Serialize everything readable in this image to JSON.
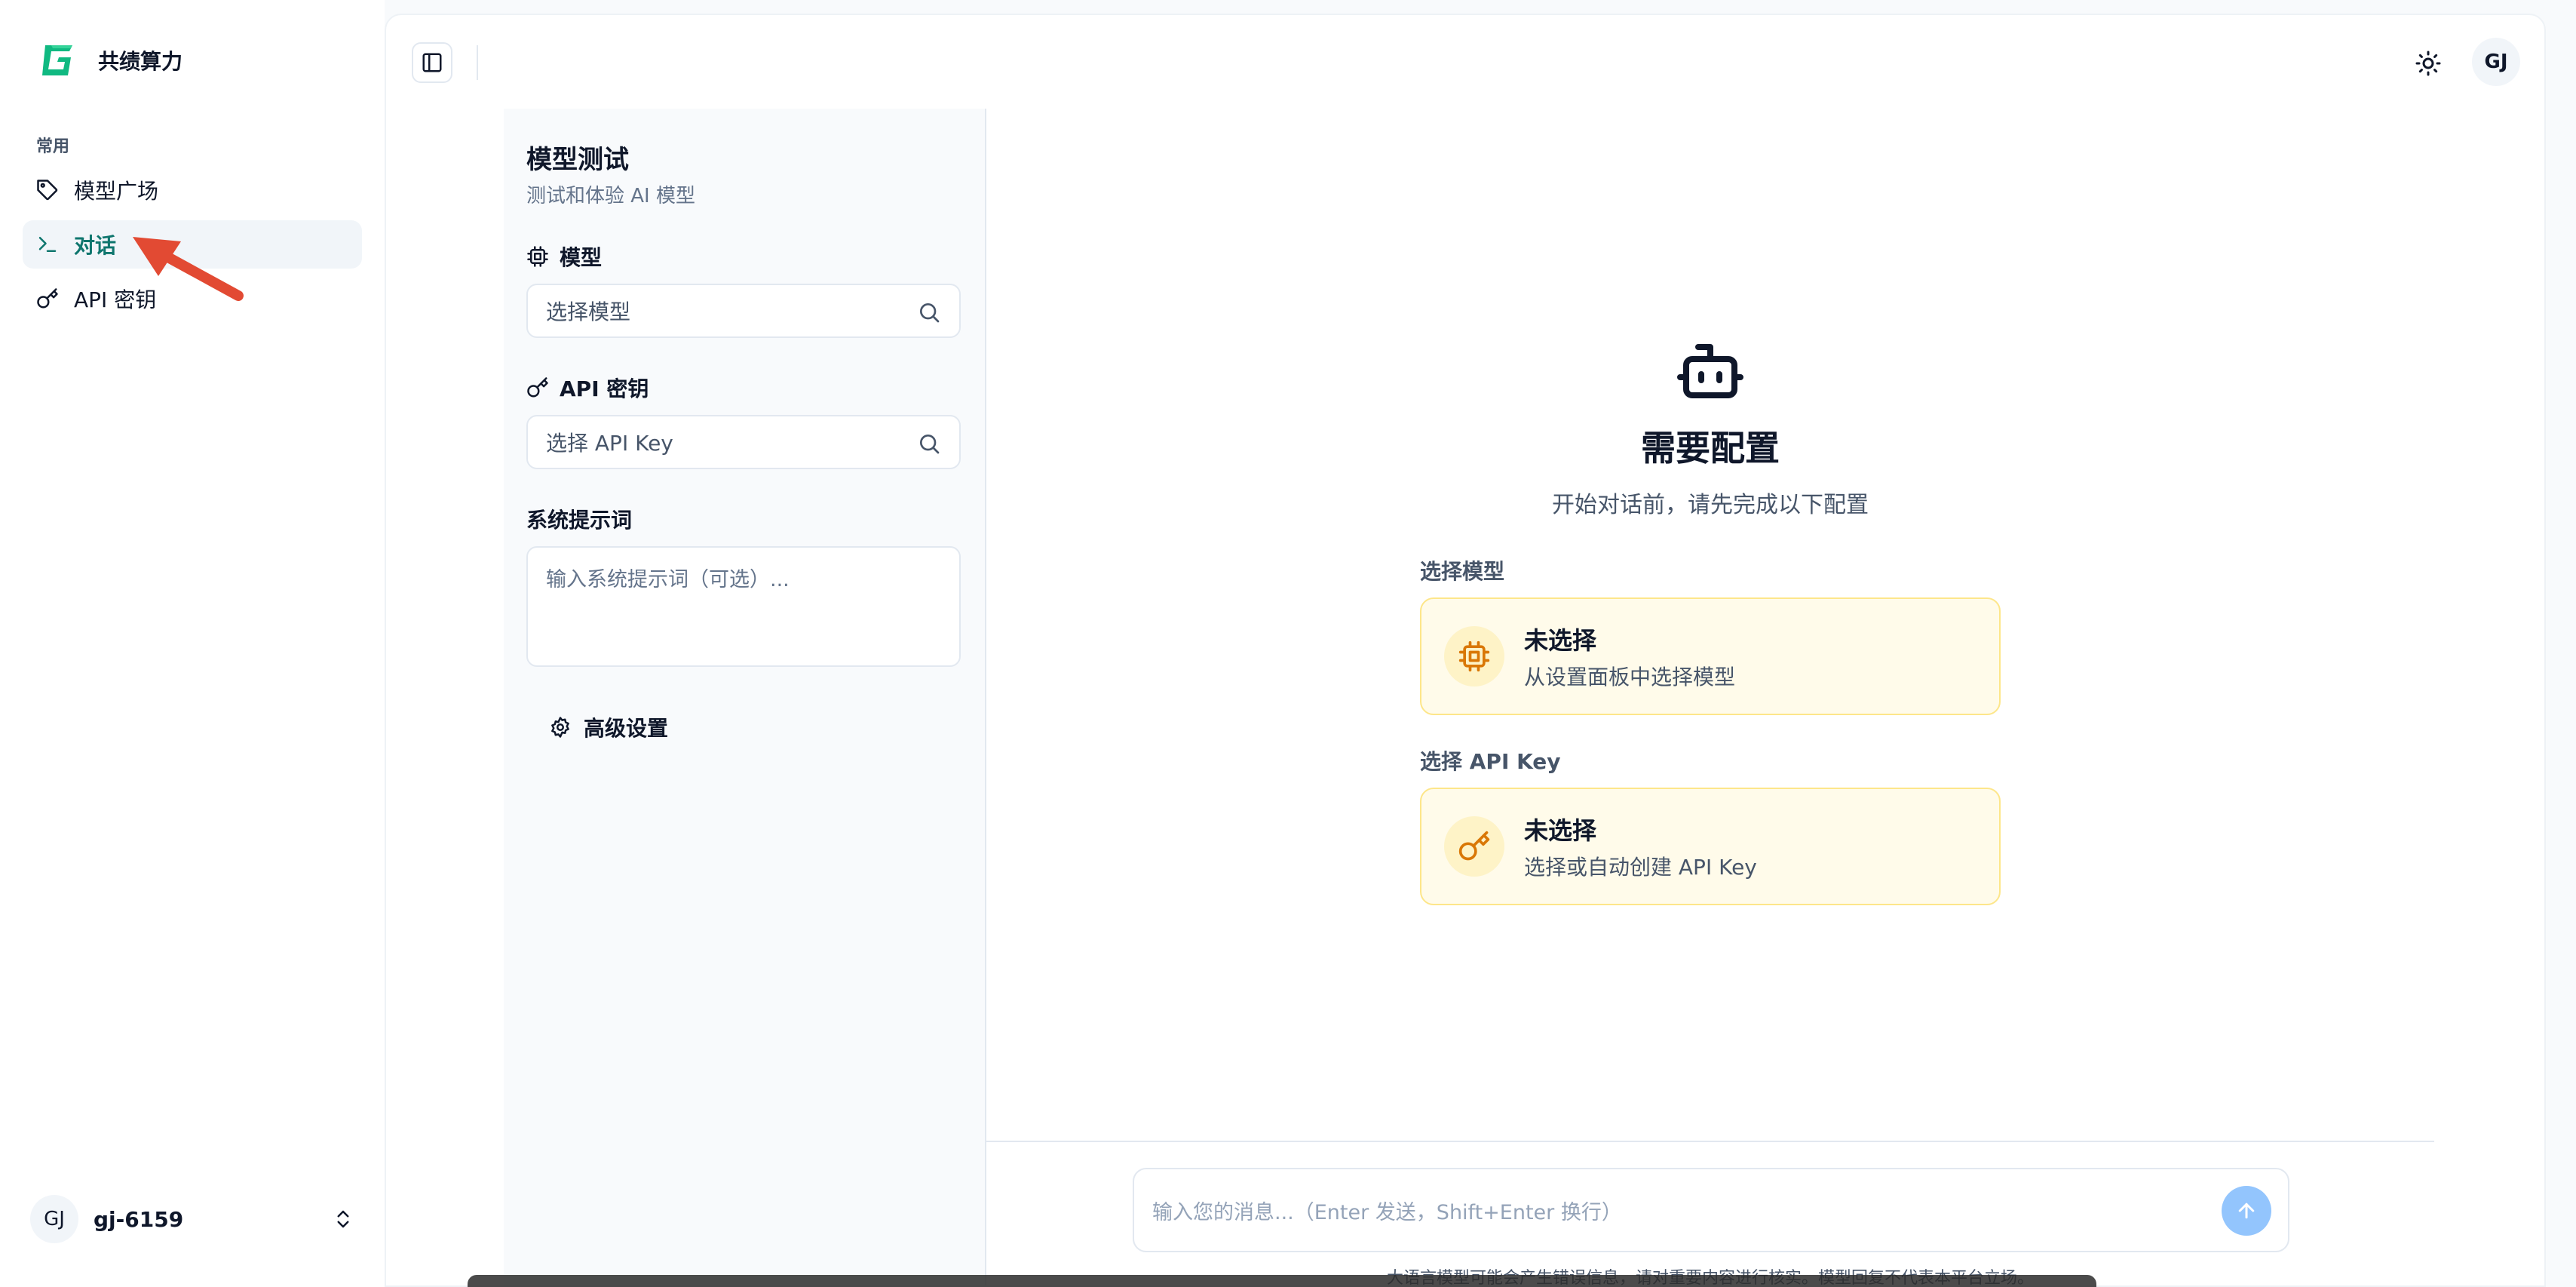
{
  "brand": {
    "name": "共绩算力",
    "accent": "#10b981"
  },
  "sidebar": {
    "section_label": "常用",
    "items": [
      {
        "label": "模型广场",
        "icon": "tag-icon"
      },
      {
        "label": "对话",
        "icon": "terminal-icon",
        "active": true
      },
      {
        "label": "API 密钥",
        "icon": "key-icon"
      }
    ],
    "user": {
      "initials": "GJ",
      "name": "gj-6159"
    }
  },
  "topbar": {
    "avatar_initials": "GJ"
  },
  "settings": {
    "title": "模型测试",
    "subtitle": "测试和体验 AI 模型",
    "model_label": "模型",
    "model_placeholder": "选择模型",
    "apikey_label": "API 密钥",
    "apikey_placeholder": "选择 API Key",
    "system_prompt_label": "系统提示词",
    "system_prompt_placeholder": "输入系统提示词（可选）...",
    "advanced_label": "高级设置"
  },
  "empty_state": {
    "title": "需要配置",
    "subtitle": "开始对话前，请先完成以下配置",
    "model_section": "选择模型",
    "model_card_title": "未选择",
    "model_card_desc": "从设置面板中选择模型",
    "key_section": "选择 API Key",
    "key_card_title": "未选择",
    "key_card_desc": "选择或自动创建 API Key"
  },
  "composer": {
    "placeholder": "输入您的消息...（Enter 发送，Shift+Enter 换行）",
    "disclaimer": "大语言模型可能会产生错误信息，请对重要内容进行核实。模型回复不代表本平台立场。"
  },
  "colors": {
    "active_text": "#0f766e",
    "warning_bg": "#fffbea",
    "warning_border": "#fde68a",
    "warning_icon": "#d97706",
    "send_button": "#93c5fd",
    "annotation_arrow": "#e24a33"
  }
}
